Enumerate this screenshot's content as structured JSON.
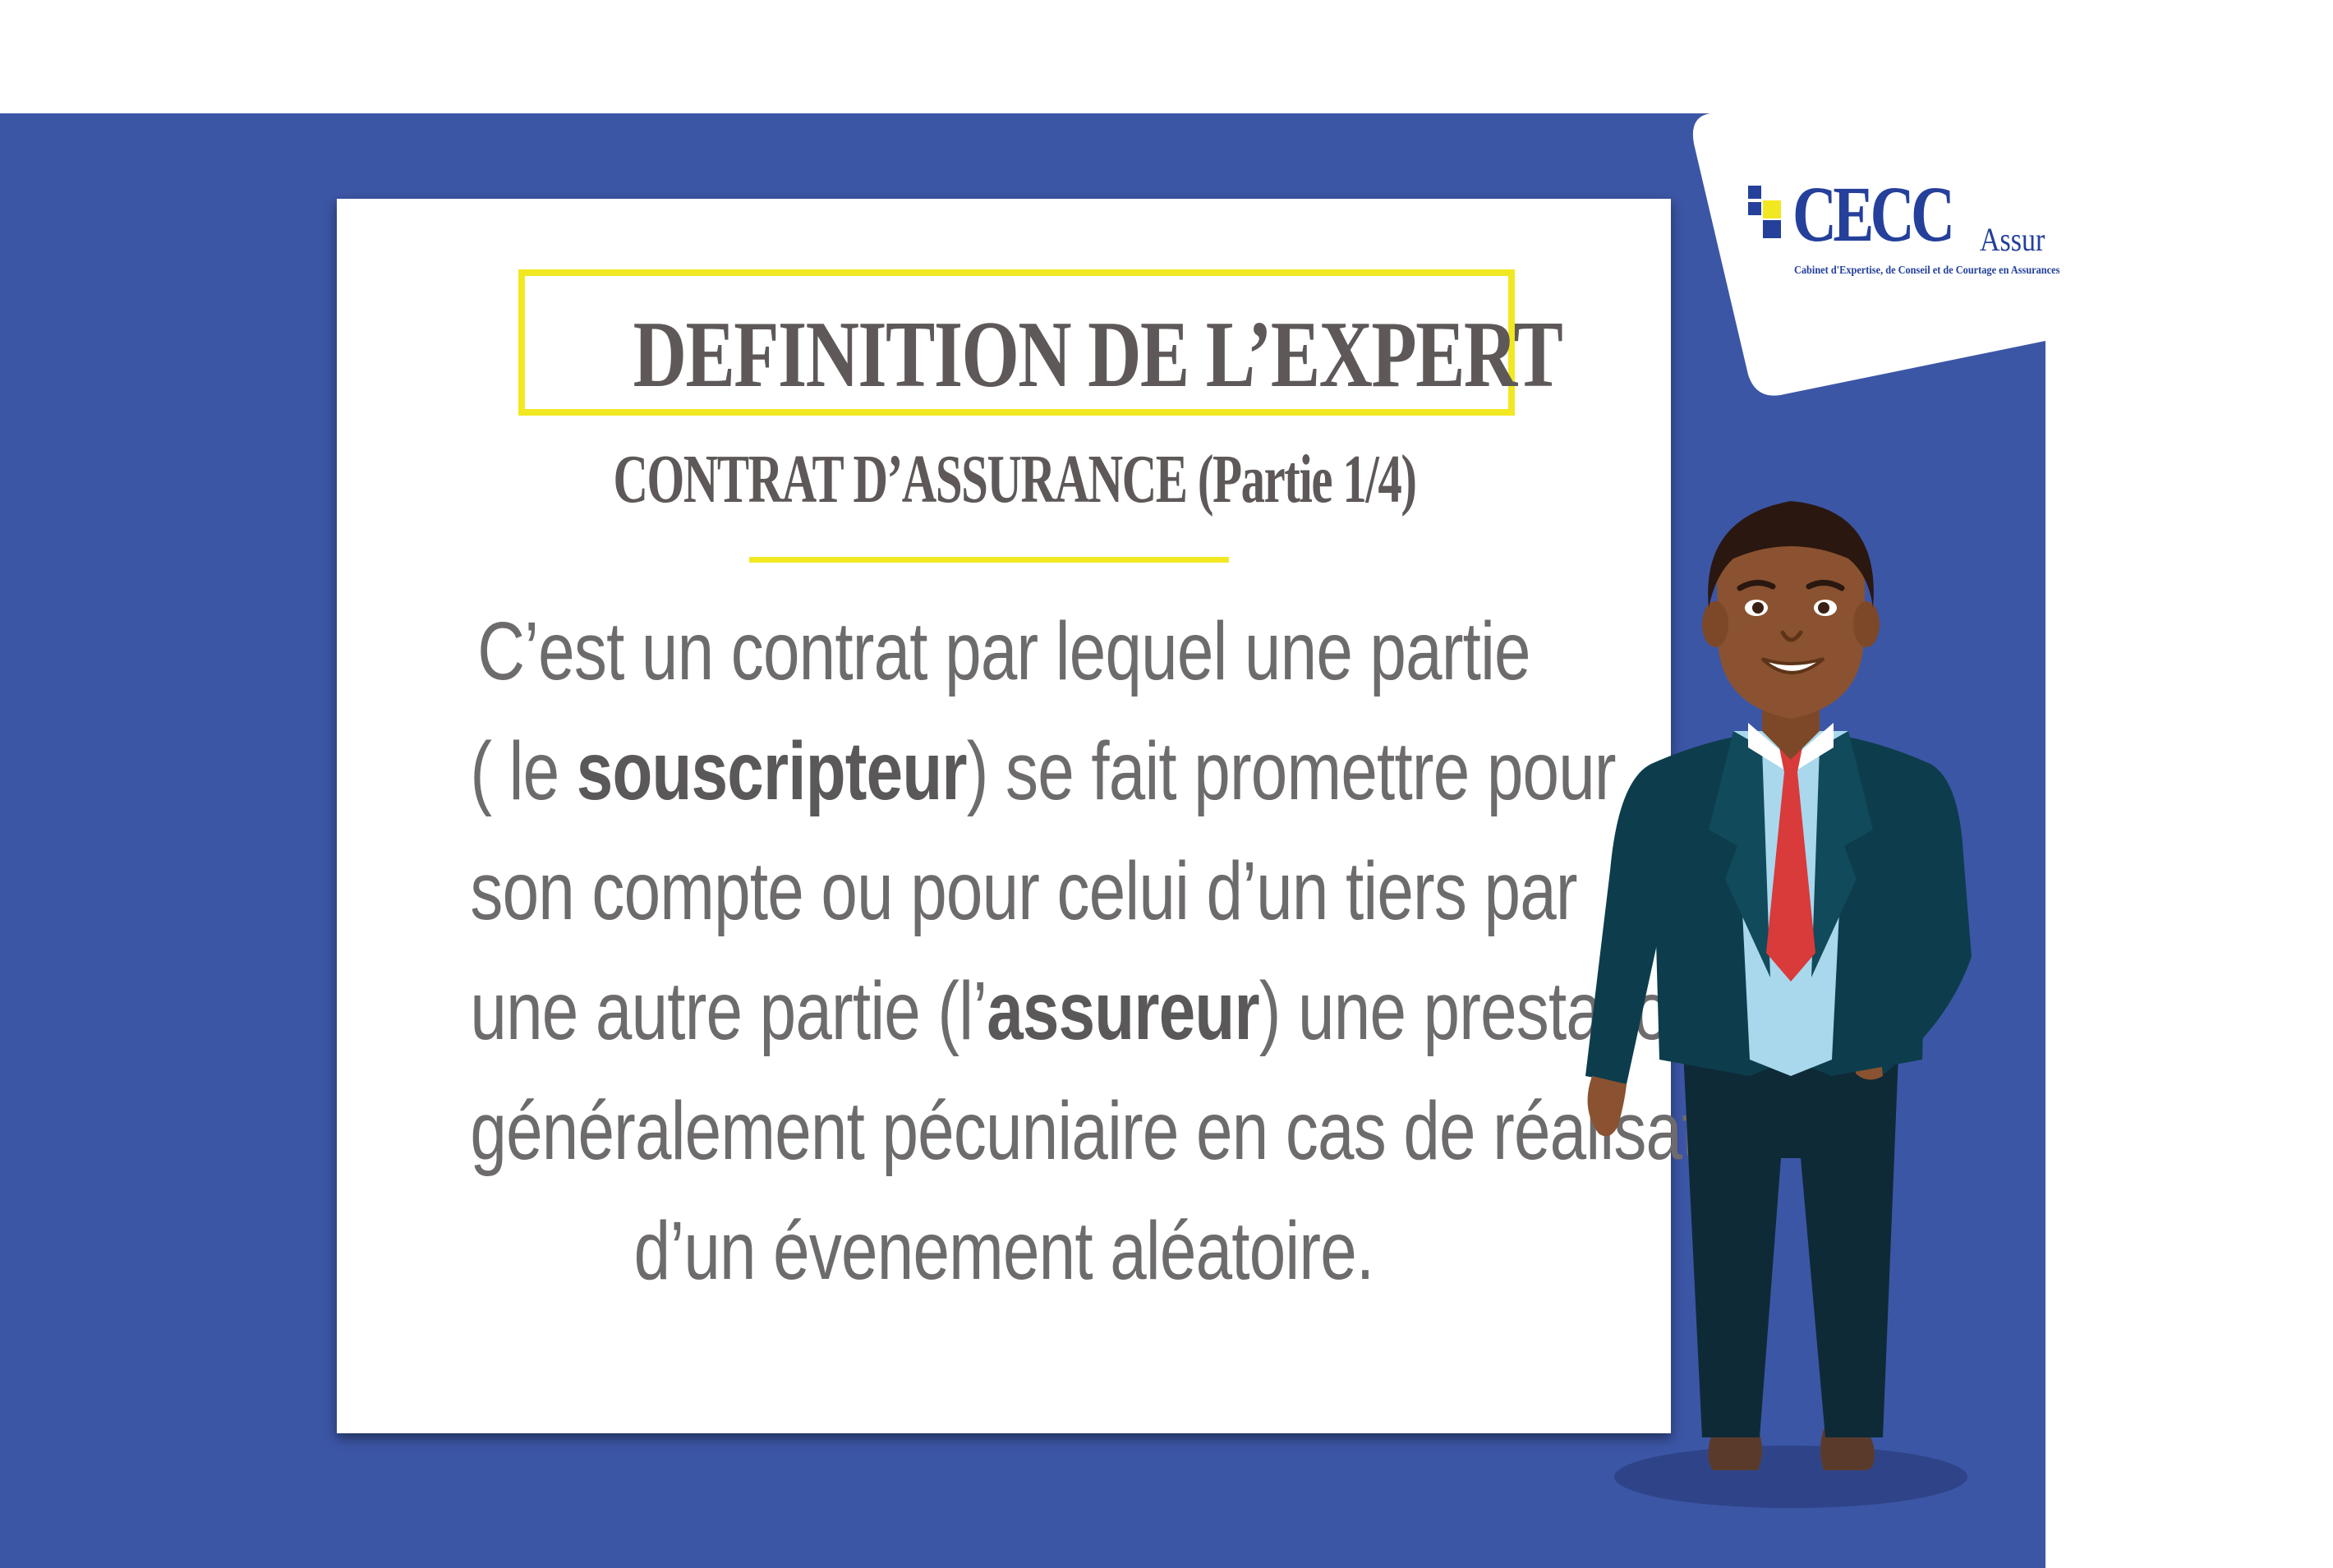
{
  "logo": {
    "main": "CECC",
    "suffix": "Assur",
    "tagline": "Cabinet d'Expertise, de Conseil et de Courtage en Assurances"
  },
  "card": {
    "title": "DEFINITION DE L’EXPERT",
    "subtitle": "CONTRAT D’ASSURANCE (Partie 1/4)",
    "body": {
      "line1": "C’est un contrat par lequel une partie",
      "line2_pre": "( le ",
      "line2_bold": "souscripteur",
      "line2_post": ") se fait promettre pour",
      "line3": "son compte ou pour celui d’un tiers par",
      "line4_pre": "une autre partie (l’",
      "line4_bold": "assureur",
      "line4_post": ") une prestation",
      "line5": "généralement pécuniaire en cas de réalisation",
      "line6": "d’un évenement aléatoire."
    }
  },
  "colors": {
    "panel_blue": "#3c56a6",
    "accent_yellow": "#f2e822",
    "text_gray": "#6e6b6c",
    "logo_blue": "#24409a"
  }
}
